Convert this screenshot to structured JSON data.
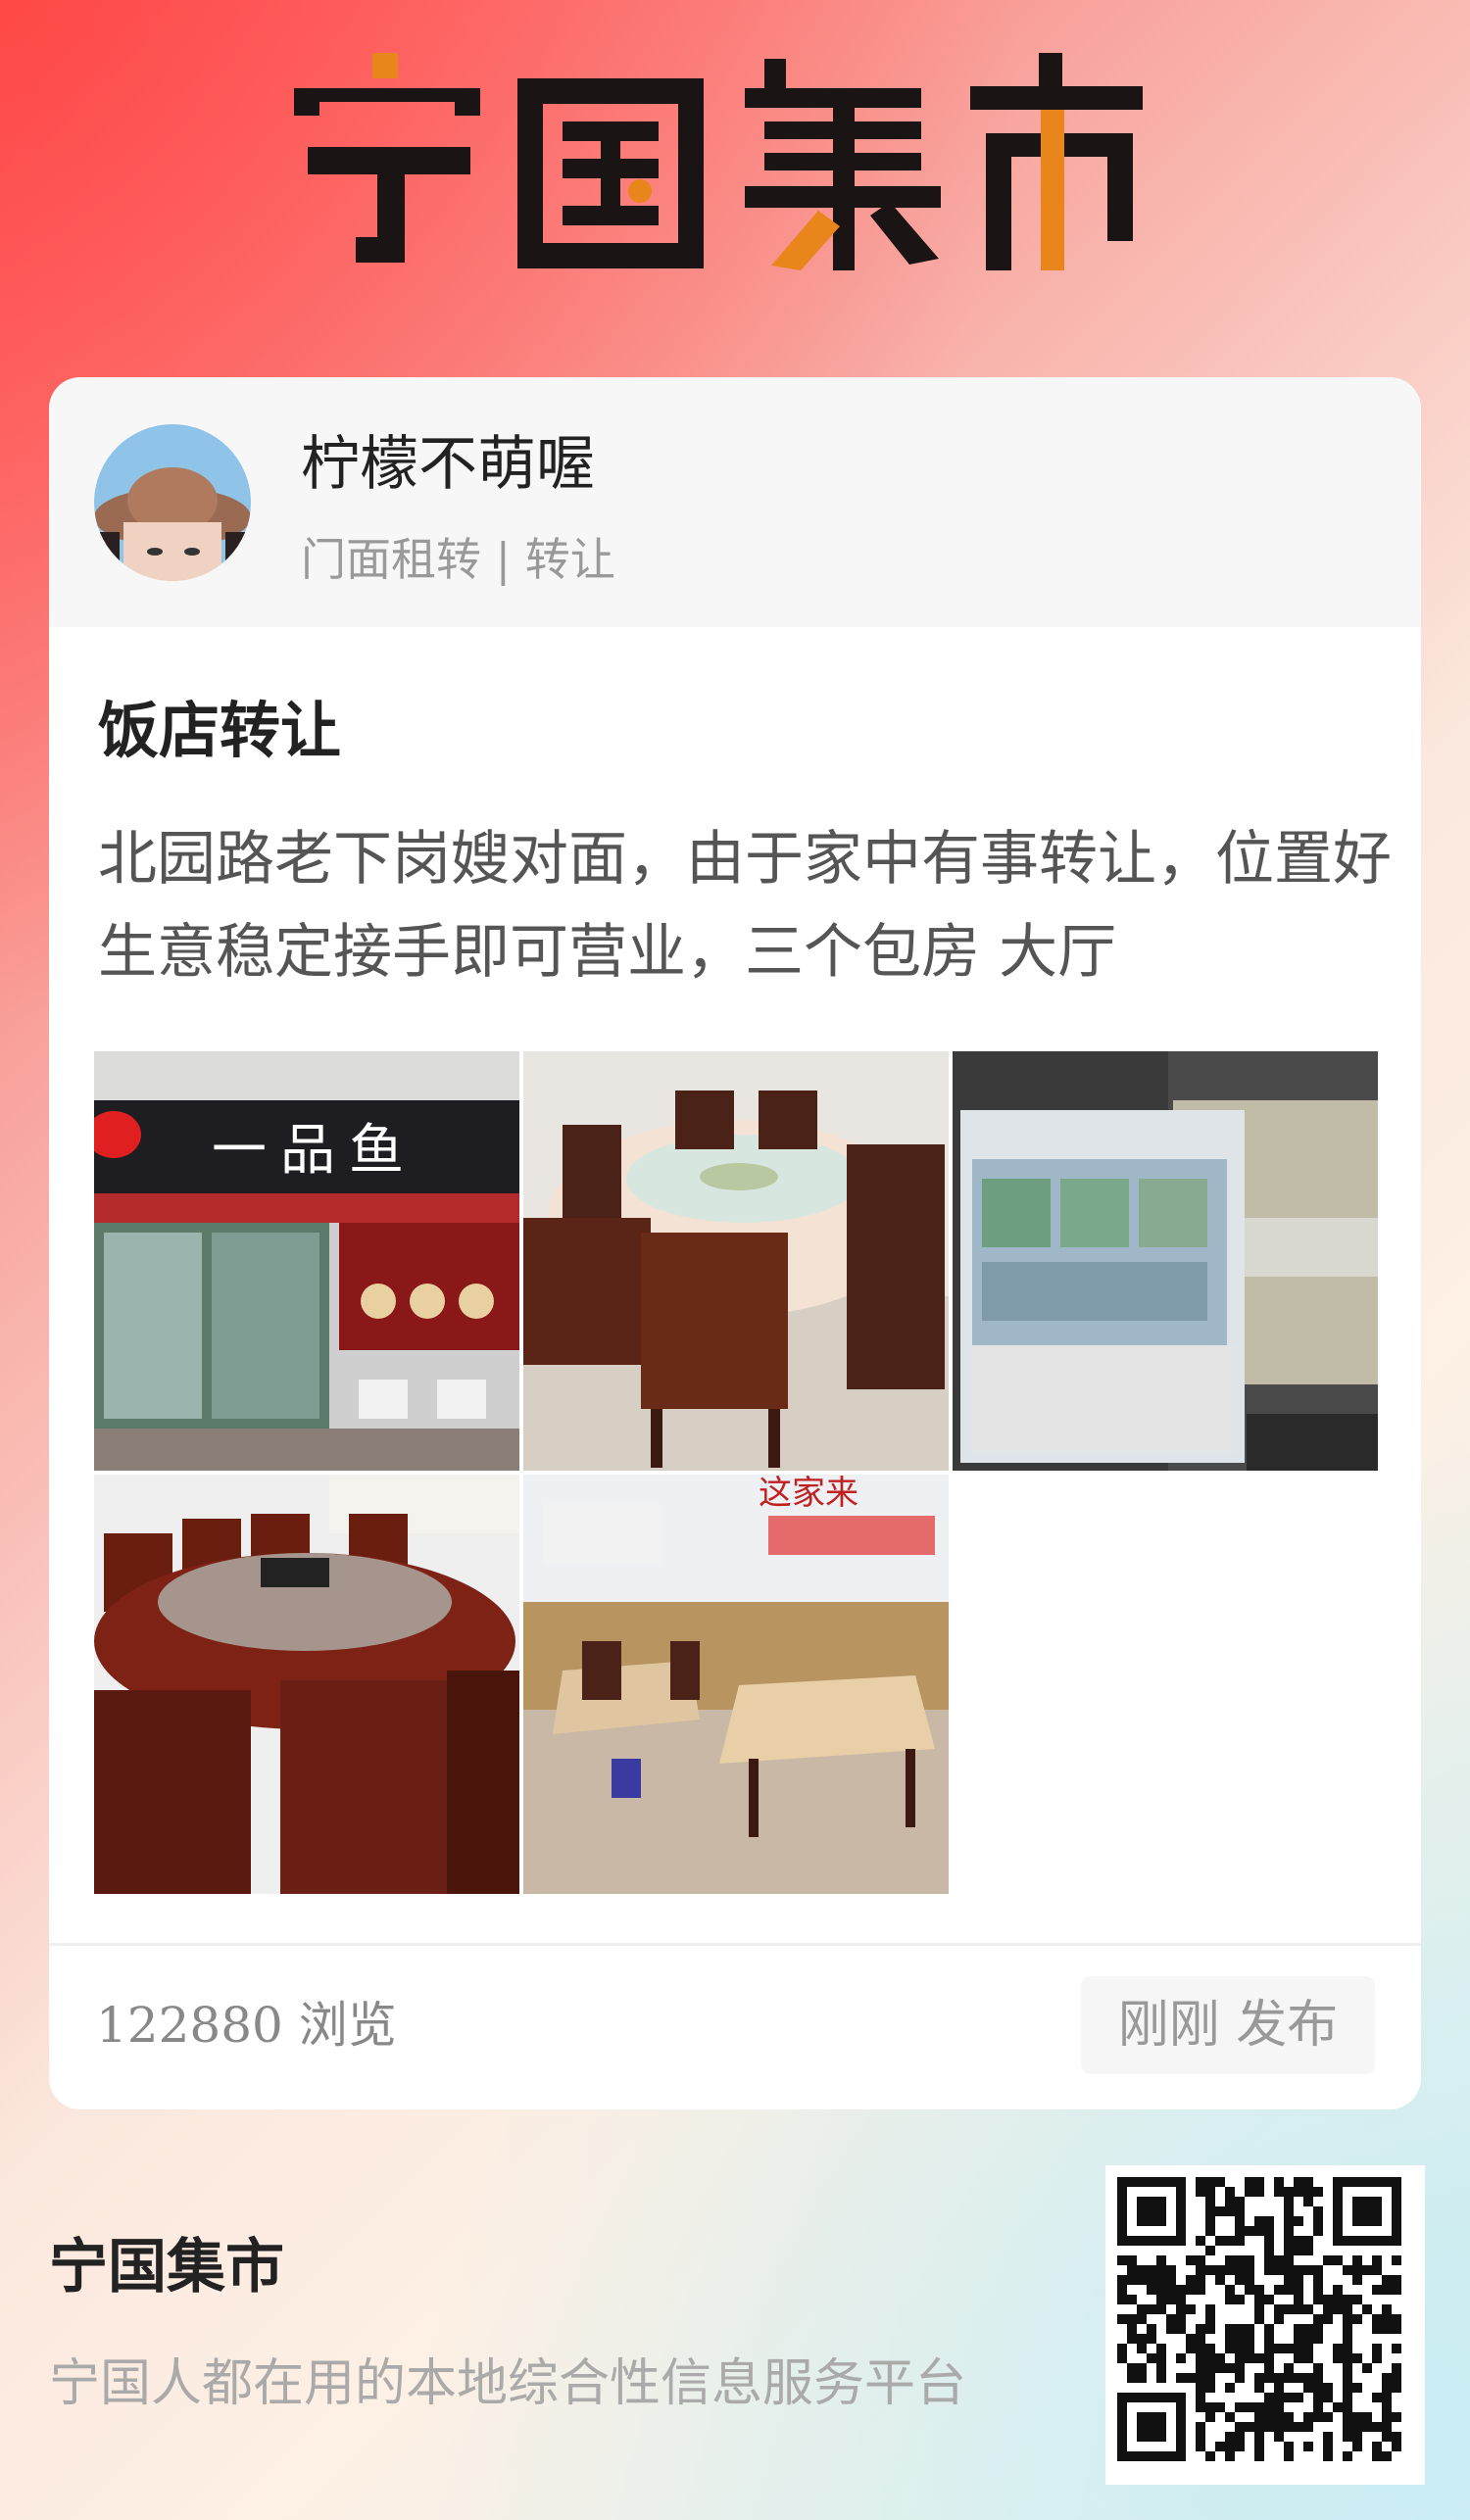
{
  "header": {
    "logo_text": "宁国集市"
  },
  "post": {
    "user": {
      "name": "柠檬不萌喔"
    },
    "category": "门面租转 | 转让",
    "title": "饭店转让",
    "body": "北园路老下岗嫂对面，由于家中有事转让，位置好生意稳定接手即可营业，三个包房 大厅",
    "photo_sign_text": "一 品 鱼",
    "photo_wall_text": "这家来",
    "stats": {
      "views": "122880 浏览"
    },
    "posted_label": "刚刚 发布"
  },
  "footer": {
    "title": "宁国集市",
    "subtitle": "宁国人都在用的本地综合性信息服务平台"
  },
  "colors": {
    "logo_dark": "#1a1414",
    "logo_accent": "#e8861c",
    "card_bg": "#ffffff",
    "header_bg": "#f7f7f7"
  }
}
